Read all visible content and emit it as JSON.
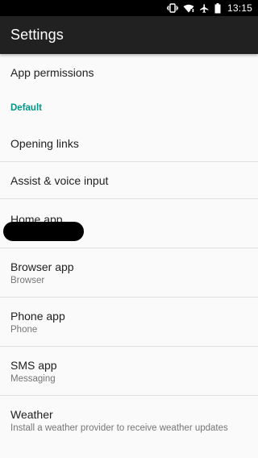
{
  "status_bar": {
    "time": "13:15",
    "icons": [
      "vibrate-icon",
      "wifi-icon",
      "airplane-icon",
      "battery-icon"
    ]
  },
  "toolbar": {
    "title": "Settings"
  },
  "list": {
    "app_permissions": "App permissions",
    "default_header": "Default",
    "opening_links": "Opening links",
    "assist_voice": "Assist & voice input",
    "home_app": {
      "title": "Home app"
    },
    "browser_app": {
      "title": "Browser app",
      "summary": "Browser"
    },
    "phone_app": {
      "title": "Phone app",
      "summary": "Phone"
    },
    "sms_app": {
      "title": "SMS app",
      "summary": "Messaging"
    },
    "weather": {
      "title": "Weather",
      "summary": "Install a weather provider to receive weather updates"
    }
  },
  "colors": {
    "accent": "#009688",
    "toolbar": "#212121",
    "background": "#fafafa"
  }
}
